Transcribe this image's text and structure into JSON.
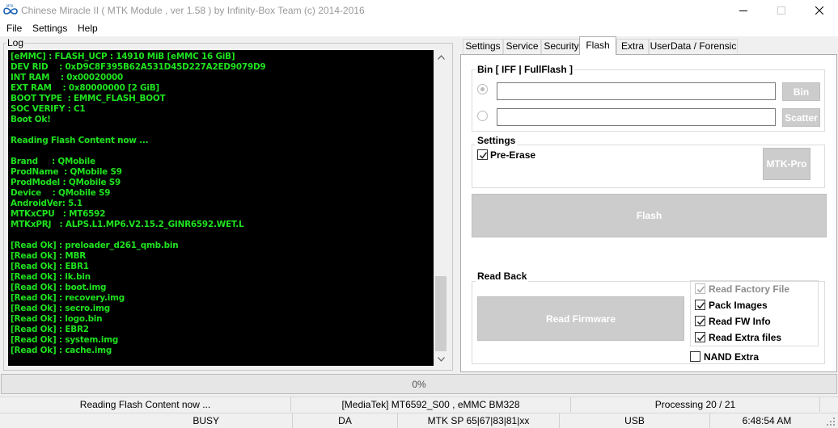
{
  "window": {
    "title": "Chinese Miracle II ( MTK Module , ver 1.58 ) by Infinity-Box Team (c) 2014-2016",
    "icon_name": "infinity-logo-icon"
  },
  "menu": [
    "File",
    "Settings",
    "Help"
  ],
  "log": {
    "legend": "Log",
    "lines": [
      "[eMMC] : FLASH_UCP : 14910 MiB [eMMC 16 GiB]",
      "DEV RID    : 0xD9C8F395B62A531D45D227A2ED9079D9",
      "INT RAM    : 0x00020000",
      "EXT RAM    : 0x80000000 [2 GiB]",
      "BOOT TYPE  : EMMC_FLASH_BOOT",
      "SOC VERIFY : C1",
      "Boot Ok!",
      "",
      "Reading Flash Content now ...",
      "",
      "Brand     : QMobile",
      "ProdName  : QMobile S9",
      "ProdModel : QMobile S9",
      "Device    : QMobile S9",
      "AndroidVer: 5.1",
      "MTKxCPU   : MT6592",
      "MTKxPRJ   : ALPS.L1.MP6.V2.15.2_GINR6592.WET.L",
      "",
      "[Read Ok] : preloader_d261_qmb.bin",
      "[Read Ok] : MBR",
      "[Read Ok] : EBR1",
      "[Read Ok] : lk.bin",
      "[Read Ok] : boot.img",
      "[Read Ok] : recovery.img",
      "[Read Ok] : secro.img",
      "[Read Ok] : logo.bin",
      "[Read Ok] : EBR2",
      "[Read Ok] : system.img",
      "[Read Ok] : cache.img"
    ]
  },
  "tabs": [
    {
      "label": "Settings",
      "active": false
    },
    {
      "label": "Service",
      "active": false
    },
    {
      "label": "Security",
      "active": false
    },
    {
      "label": "Flash",
      "active": true
    },
    {
      "label": "Extra",
      "active": false
    },
    {
      "label": "UserData / Forensic",
      "active": false
    }
  ],
  "flash": {
    "bin_group": {
      "legend": "Bin  [ IFF | FullFlash ]",
      "bin_path": "",
      "scatter_path": "",
      "bin_button": "Bin",
      "scatter_button": "Scatter",
      "selected_option": "bin"
    },
    "settings_group": {
      "legend": "Settings",
      "pre_erase_label": "Pre-Erase",
      "pre_erase_checked": true,
      "mtk_pro_button": "MTK-Pro"
    },
    "flash_button": "Flash",
    "read_back": {
      "legend": "Read Back",
      "read_firmware_button": "Read Firmware",
      "options": [
        {
          "label": "Read Factory File",
          "checked": true,
          "enabled": false
        },
        {
          "label": "Pack Images",
          "checked": true,
          "enabled": true
        },
        {
          "label": "Read FW Info",
          "checked": true,
          "enabled": true
        },
        {
          "label": "Read Extra files",
          "checked": true,
          "enabled": true
        }
      ],
      "nand_extra_label": "NAND Extra",
      "nand_extra_checked": false
    }
  },
  "progress": {
    "text": "0%",
    "value": 0
  },
  "status_row1": [
    "Reading Flash Content now ...",
    "[MediaTek] MT6592_S00 , eMMC BM328",
    "Processing 20 / 21"
  ],
  "status_row2": [
    "BUSY",
    "DA",
    "MTK SP 65|67|83|81|xx",
    "USB",
    "6:48:54 AM"
  ],
  "colors": {
    "log_text": "#1fe21f",
    "log_bg": "#000000",
    "window_bg": "#f0f0f0",
    "disabled_button": "#cccccc"
  }
}
